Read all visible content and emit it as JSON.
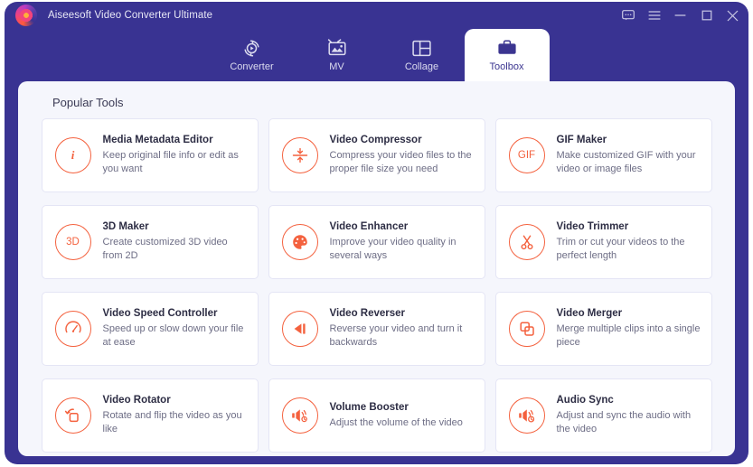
{
  "window": {
    "title": "Aiseesoft Video Converter Ultimate",
    "logo_icon": "aiseesoft-swirl-logo",
    "controls": [
      {
        "name": "feedback-icon",
        "label": "Feedback"
      },
      {
        "name": "menu-icon",
        "label": "Menu"
      },
      {
        "name": "minimize-icon",
        "label": "Minimize"
      },
      {
        "name": "maximize-icon",
        "label": "Maximize"
      },
      {
        "name": "close-icon",
        "label": "Close"
      }
    ]
  },
  "theme": {
    "header_purple": "#393392",
    "panel_background": "#f5f6fc",
    "card_background": "#ffffff",
    "accent_orange": "#f4613e",
    "tab_active_background": "#ffffff",
    "tab_active_text": "#3b3590"
  },
  "tabs": [
    {
      "label": "Converter",
      "icon": "converter-icon",
      "active": false
    },
    {
      "label": "MV",
      "icon": "mv-icon",
      "active": false
    },
    {
      "label": "Collage",
      "icon": "collage-icon",
      "active": false
    },
    {
      "label": "Toolbox",
      "icon": "toolbox-icon",
      "active": true
    }
  ],
  "content": {
    "section_title": "Popular Tools",
    "tools": [
      {
        "name": "Media Metadata Editor",
        "desc": "Keep original file info or edit as you want",
        "icon": "info-icon"
      },
      {
        "name": "Video Compressor",
        "desc": "Compress your video files to the proper file size you need",
        "icon": "compress-icon"
      },
      {
        "name": "GIF Maker",
        "desc": "Make customized GIF with your video or image files",
        "icon": "gif-icon"
      },
      {
        "name": "3D Maker",
        "desc": "Create customized 3D video from 2D",
        "icon": "3d-icon"
      },
      {
        "name": "Video Enhancer",
        "desc": "Improve your video quality in several ways",
        "icon": "palette-icon"
      },
      {
        "name": "Video Trimmer",
        "desc": "Trim or cut your videos to the perfect length",
        "icon": "scissors-icon"
      },
      {
        "name": "Video Speed Controller",
        "desc": "Speed up or slow down your file at ease",
        "icon": "speedometer-icon"
      },
      {
        "name": "Video Reverser",
        "desc": "Reverse your video and turn it backwards",
        "icon": "rewind-icon"
      },
      {
        "name": "Video Merger",
        "desc": "Merge multiple clips into a single piece",
        "icon": "merge-squares-icon"
      },
      {
        "name": "Video Rotator",
        "desc": "Rotate and flip the video as you like",
        "icon": "rotate-icon"
      },
      {
        "name": "Volume Booster",
        "desc": "Adjust the volume of the video",
        "icon": "speaker-volume-icon"
      },
      {
        "name": "Audio Sync",
        "desc": "Adjust and sync the audio with the video",
        "icon": "speaker-clock-icon"
      }
    ]
  }
}
